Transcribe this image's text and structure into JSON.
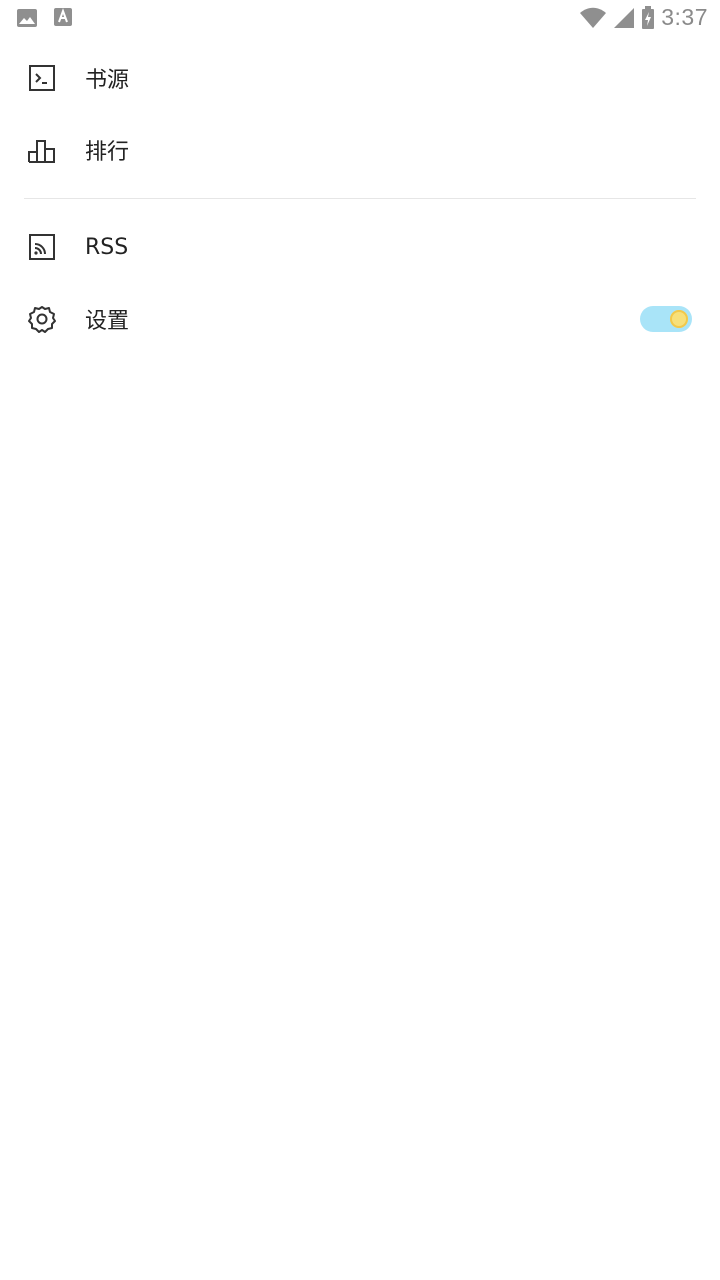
{
  "status_bar": {
    "time": "3:37",
    "left_icons": [
      "image-icon",
      "font-icon"
    ],
    "right_icons": [
      "wifi-icon",
      "signal-icon",
      "battery-charging-icon"
    ]
  },
  "menu": {
    "items": [
      {
        "label": "书源",
        "icon": "terminal-icon"
      },
      {
        "label": "排行",
        "icon": "ranking-icon"
      },
      {
        "label": "RSS",
        "icon": "rss-icon"
      },
      {
        "label": "设置",
        "icon": "gear-icon",
        "toggle_on": true
      }
    ]
  },
  "colors": {
    "toggle_track": "#a9e4f8",
    "toggle_knob": "#f7e07a",
    "text": "#222222",
    "status_text": "#8a8a8a"
  }
}
